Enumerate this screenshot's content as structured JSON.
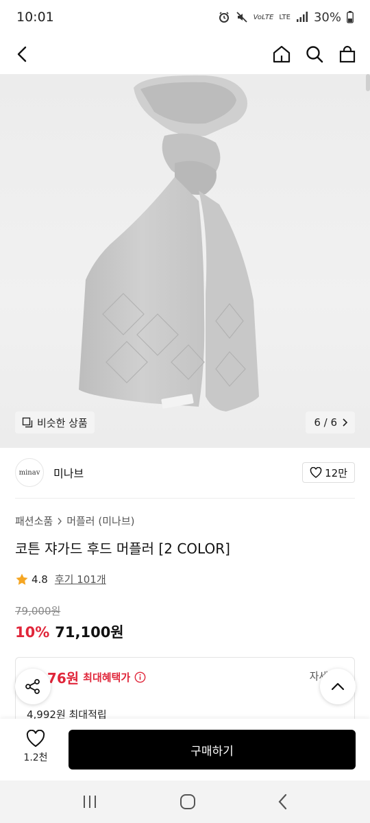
{
  "status": {
    "time": "10:01",
    "battery": "30%",
    "network": "LTE"
  },
  "gallery": {
    "similar_label": "비슷한 상품",
    "counter": "6 / 6"
  },
  "brand": {
    "logo_text": "minav",
    "name": "미나브",
    "likes": "12만"
  },
  "breadcrumb": {
    "category": "패션소품",
    "subcategory": "머플러 (미나브)"
  },
  "product": {
    "title": "코튼 쟈가드 후드 머플러 [2 COLOR]",
    "rating": "4.8",
    "reviews": "후기 101개",
    "original_price": "79,000원",
    "discount": "10%",
    "price": "71,100원"
  },
  "benefit": {
    "amount": "076원",
    "label": "최대혜택가",
    "detail": "자세히",
    "points": "4,992원 최대적립"
  },
  "bottom": {
    "wish_count": "1.2천",
    "buy_label": "구매하기"
  },
  "colors": {
    "accent": "#e0263a",
    "button": "#000000"
  }
}
